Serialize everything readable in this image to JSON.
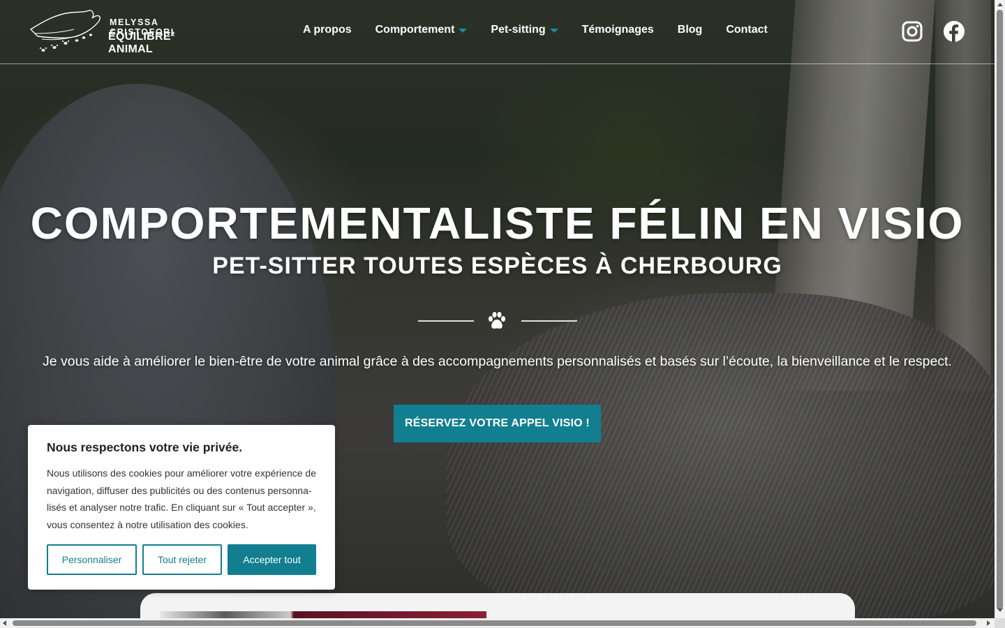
{
  "header": {
    "logo_name": "MELYSSA CRISTOFORI",
    "logo_brand": "ÉQUILIBRE² ANIMAL",
    "nav": [
      {
        "label": "A propos",
        "has_dropdown": false
      },
      {
        "label": "Comportement",
        "has_dropdown": true
      },
      {
        "label": "Pet-sitting",
        "has_dropdown": true
      },
      {
        "label": "Témoignages",
        "has_dropdown": false
      },
      {
        "label": "Blog",
        "has_dropdown": false
      },
      {
        "label": "Contact",
        "has_dropdown": false
      }
    ],
    "social": [
      {
        "icon": "instagram-icon"
      },
      {
        "icon": "facebook-icon"
      }
    ]
  },
  "hero": {
    "title": "COMPORTEMENTALISTE FÉLIN EN VISIO",
    "subtitle": "PET-SITTER TOUTES ESPÈCES À CHERBOURG",
    "divider_icon": "paw-icon",
    "description": "Je vous aide à améliorer le bien-être de votre animal grâce à des accompagnements personnalisés et basés sur l’écoute, la bienveillance et le respect.",
    "cta_label": "RÉSERVEZ VOTRE APPEL VISIO !"
  },
  "cookie": {
    "title": "Nous respectons votre vie privée.",
    "text": "Nous utilisons des cookies pour améliorer votre expérience de navigation, diffuser des publicités ou des contenus personna­lisés et analyser notre trafic. En cliquant sur « Tout accepter », vous consentez à notre utilisation des cookies.",
    "customize_label": "Personnaliser",
    "reject_label": "Tout rejeter",
    "accept_label": "Accepter tout"
  },
  "colors": {
    "accent": "#127f90",
    "caret": "#1a8a9b",
    "text_on_hero": "#ffffff"
  }
}
